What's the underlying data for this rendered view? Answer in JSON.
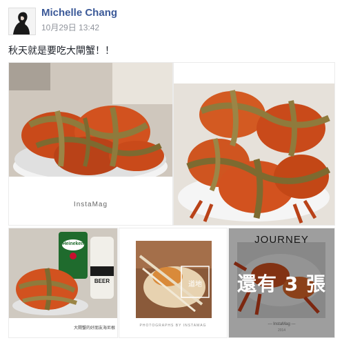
{
  "post": {
    "author": "Michelle Chang",
    "timestamp": "10月29日 13:42",
    "text": "秋天就是要吃大閘蟹！！"
  },
  "photos": {
    "photo1_caption": "InstaMag",
    "photo3_can_label": "Heineken",
    "photo3_bottle_label": "BEER",
    "photo3_caption": "大閘蟹的好朋友海尼根",
    "photo4_overlay": "道地",
    "photo4_caption": "PHOTOGRAPHS BY INSTAMAG",
    "photo5_title": "JOURNEY",
    "photo5_caption": "--- InstaMag ---",
    "photo5_year": "2014"
  },
  "more_photos_label": "還有 3 張",
  "colors": {
    "link": "#3b5998",
    "crab_shell": "#d2521f",
    "straw": "#8f7a3c",
    "overlay": "#000000"
  }
}
